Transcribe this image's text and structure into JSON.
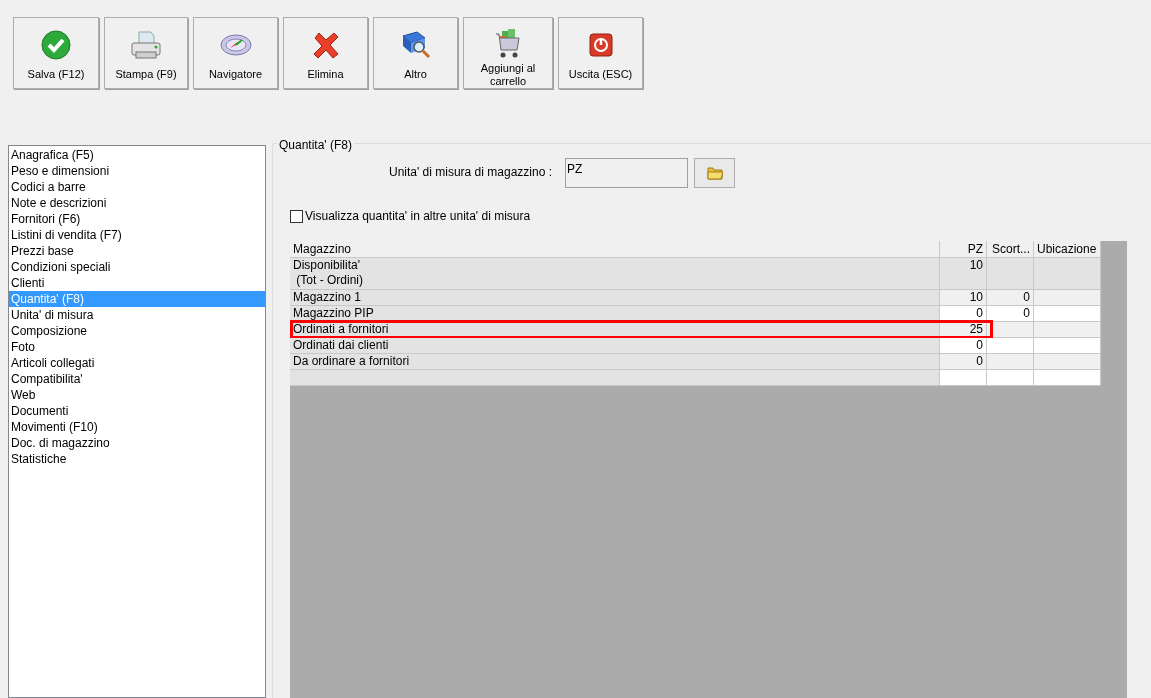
{
  "toolbar": [
    {
      "label": "Salva (F12)"
    },
    {
      "label": "Stampa (F9)"
    },
    {
      "label": "Navigatore"
    },
    {
      "label": "Elimina"
    },
    {
      "label": "Altro"
    },
    {
      "label": "Aggiungi al carrello"
    },
    {
      "label": "Uscita (ESC)"
    }
  ],
  "sidebar": {
    "items": [
      {
        "label": "Anagrafica (F5)",
        "selected": false
      },
      {
        "label": "Peso e dimensioni",
        "selected": false
      },
      {
        "label": "Codici a barre",
        "selected": false
      },
      {
        "label": "Note e descrizioni",
        "selected": false
      },
      {
        "label": "Fornitori (F6)",
        "selected": false
      },
      {
        "label": "Listini di vendita (F7)",
        "selected": false
      },
      {
        "label": "Prezzi base",
        "selected": false
      },
      {
        "label": "Condizioni speciali",
        "selected": false
      },
      {
        "label": "Clienti",
        "selected": false
      },
      {
        "label": "Quantita' (F8)",
        "selected": true
      },
      {
        "label": "Unita' di misura",
        "selected": false
      },
      {
        "label": "Composizione",
        "selected": false
      },
      {
        "label": "Foto",
        "selected": false
      },
      {
        "label": "Articoli collegati",
        "selected": false
      },
      {
        "label": "Compatibilita'",
        "selected": false
      },
      {
        "label": "Web",
        "selected": false
      },
      {
        "label": "Documenti",
        "selected": false
      },
      {
        "label": "Movimenti (F10)",
        "selected": false
      },
      {
        "label": "Doc. di magazzino",
        "selected": false
      },
      {
        "label": "Statistiche",
        "selected": false
      }
    ]
  },
  "panel": {
    "title": "Quantita' (F8)",
    "unit_label": "Unita' di misura di magazzino :",
    "unit_value": "PZ",
    "checkbox": {
      "label": "Visualizza quantita' in altre unita' di misura",
      "checked": false
    }
  },
  "table": {
    "columns": [
      "Magazzino",
      "PZ",
      "Scort...",
      "Ubicazione"
    ],
    "rows": [
      {
        "lines": [
          "Disponibilita'",
          " (Tot - Ordini)"
        ],
        "pz": "10",
        "scorte": "",
        "highlighted": false
      },
      {
        "lines": [
          "Magazzino 1"
        ],
        "pz": "10",
        "scorte": "0",
        "highlighted": false
      },
      {
        "lines": [
          "Magazzino PIP"
        ],
        "pz": "0",
        "scorte": "0",
        "highlighted": false
      },
      {
        "lines": [
          "Ordinati a fornitori"
        ],
        "pz": "25",
        "scorte": "",
        "highlighted": true
      },
      {
        "lines": [
          "Ordinati dai clienti"
        ],
        "pz": "0",
        "scorte": "",
        "highlighted": false
      },
      {
        "lines": [
          "Da ordinare a fornitori"
        ],
        "pz": "0",
        "scorte": "",
        "highlighted": false
      }
    ]
  }
}
